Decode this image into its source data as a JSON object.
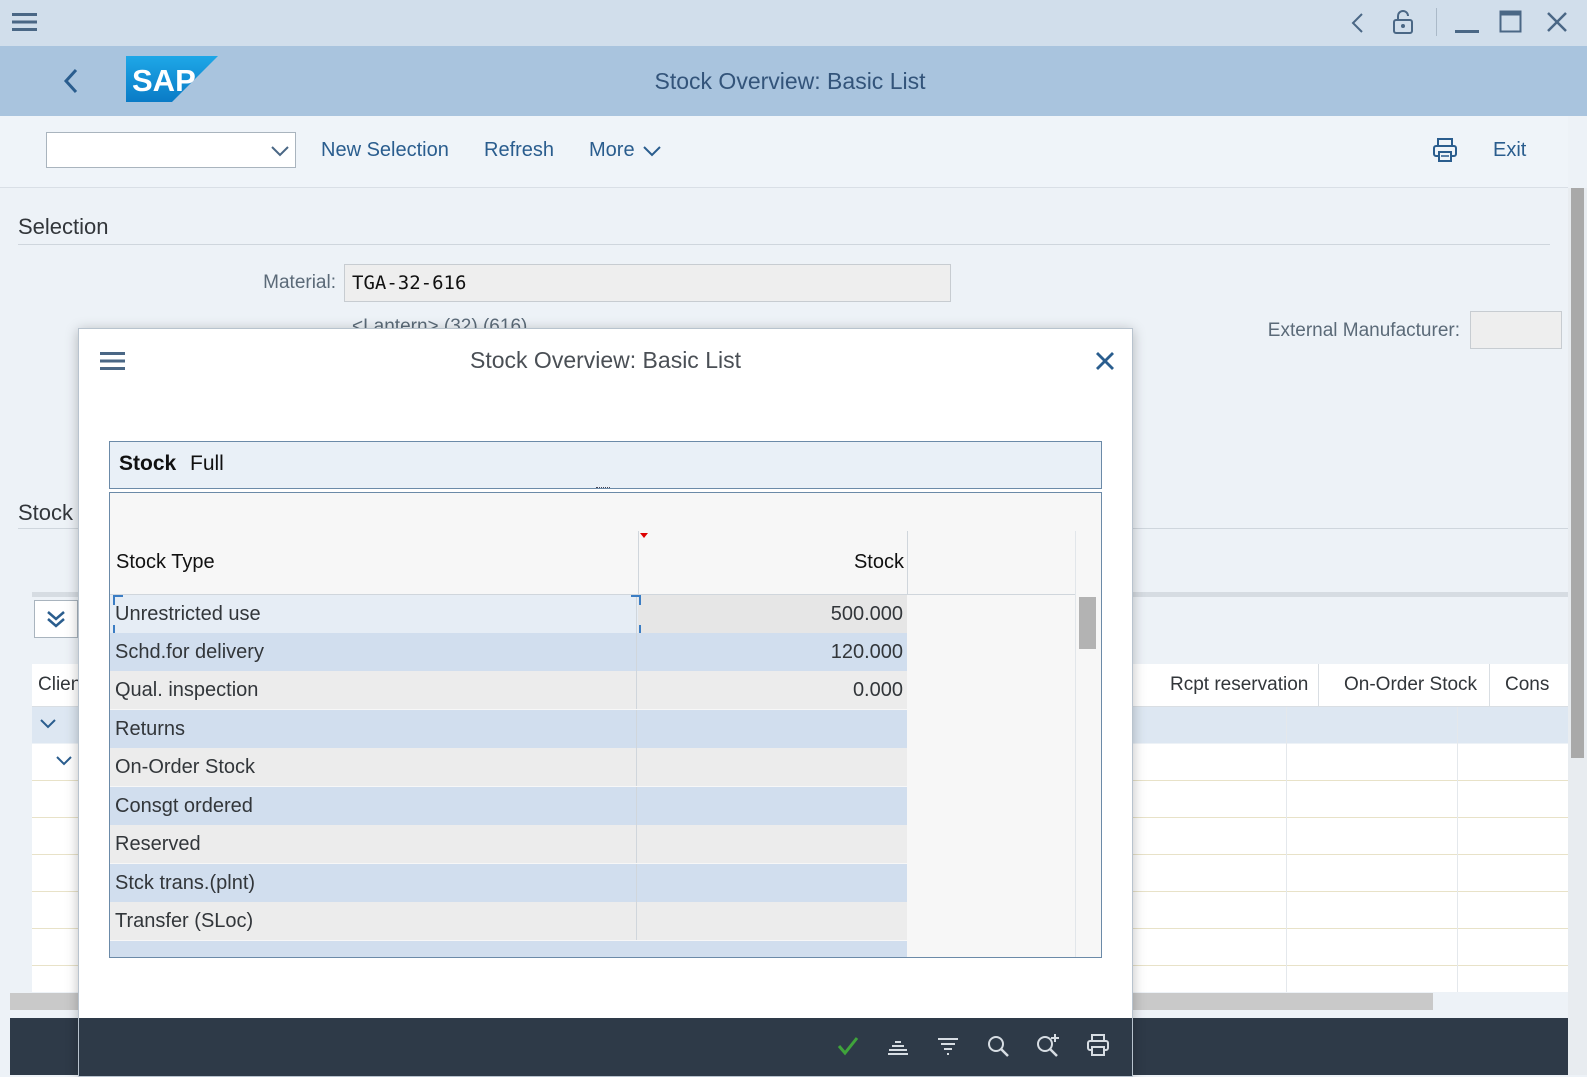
{
  "window": {
    "title": "Stock Overview: Basic List"
  },
  "toolbar": {
    "dropdown_value": "",
    "new_selection": "New Selection",
    "refresh": "Refresh",
    "more": "More",
    "exit": "Exit"
  },
  "selection": {
    "heading": "Selection",
    "material_label": "Material:",
    "material_value": "TGA-32-616",
    "partial_line": "<Lantern> (32) (616)",
    "ext_manufacturer_label": "External Manufacturer:"
  },
  "stock_section": {
    "heading": "Stock",
    "columns": [
      "Clien",
      "Rcpt reservation",
      "On-Order Stock",
      "Cons"
    ]
  },
  "modal": {
    "title": "Stock Overview: Basic List",
    "panel_title_bold": "Stock",
    "panel_title_rest": "Full",
    "col_stock_type": "Stock Type",
    "col_stock": "Stock",
    "rows": [
      {
        "type": "Unrestricted use",
        "stock": "500.000"
      },
      {
        "type": "Schd.for delivery",
        "stock": "120.000"
      },
      {
        "type": "Qual. inspection",
        "stock": "0.000"
      },
      {
        "type": "Returns",
        "stock": ""
      },
      {
        "type": "On-Order Stock",
        "stock": ""
      },
      {
        "type": "Consgt ordered",
        "stock": ""
      },
      {
        "type": "Reserved",
        "stock": ""
      },
      {
        "type": "Stck trans.(plnt)",
        "stock": ""
      },
      {
        "type": "Transfer (SLoc)",
        "stock": ""
      }
    ]
  },
  "icons": {
    "menu": "hamburger-menu-icon",
    "back": "chevron-left-icon",
    "logo": "sap-logo",
    "print": "printer-icon",
    "close": "close-icon",
    "check": "checkmark-icon"
  },
  "colors": {
    "shellbar": "#a9c4de",
    "link": "#2a5d8e",
    "footer": "#2e3a48",
    "accent_check": "#3fa33b"
  }
}
